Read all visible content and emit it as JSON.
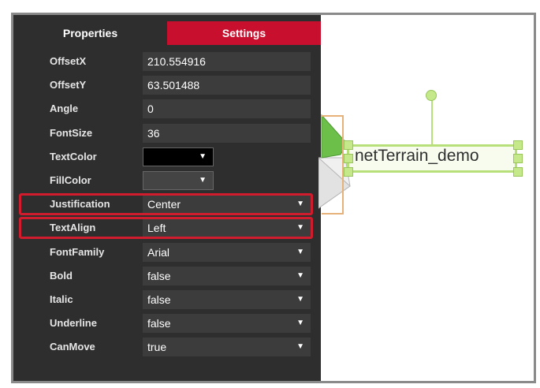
{
  "tabs": {
    "properties": "Properties",
    "settings": "Settings"
  },
  "properties": [
    {
      "label": "OffsetX",
      "value": "210.554916",
      "type": "text"
    },
    {
      "label": "OffsetY",
      "value": "63.501488",
      "type": "text"
    },
    {
      "label": "Angle",
      "value": "0",
      "type": "text"
    },
    {
      "label": "FontSize",
      "value": "36",
      "type": "text"
    },
    {
      "label": "TextColor",
      "value": "",
      "type": "color",
      "color": "#000000"
    },
    {
      "label": "FillColor",
      "value": "",
      "type": "color",
      "color": "#444444"
    },
    {
      "label": "Justification",
      "value": "Center",
      "type": "select"
    },
    {
      "label": "TextAlign",
      "value": "Left",
      "type": "select"
    },
    {
      "label": "FontFamily",
      "value": "Arial",
      "type": "select"
    },
    {
      "label": "Bold",
      "value": "false",
      "type": "select"
    },
    {
      "label": "Italic",
      "value": "false",
      "type": "select"
    },
    {
      "label": "Underline",
      "value": "false",
      "type": "select"
    },
    {
      "label": "CanMove",
      "value": "true",
      "type": "select"
    }
  ],
  "highlighted_rows": [
    "Justification",
    "TextAlign"
  ],
  "canvas": {
    "node_label": "netTerrain_demo"
  },
  "colors": {
    "panel_bg": "#2e2e2e",
    "active_tab": "#c8102e",
    "highlight_border": "#d01c2c",
    "selection_green": "#b7e07a",
    "icon_green": "#6cc04a"
  },
  "icons": {
    "dropdown": "caret-down-icon",
    "node_icon": "envelope-icon"
  }
}
